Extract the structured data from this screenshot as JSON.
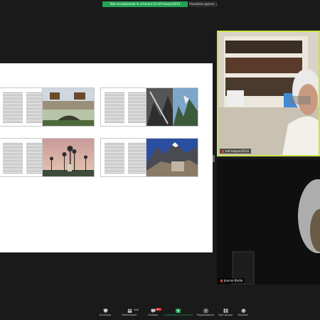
{
  "app": {
    "accent": "#23a455",
    "bg": "#1a1a1a"
  },
  "banner": {
    "share_text": "Stai visualizzando lo schermo di imf-macpro2014",
    "view_options_label": "Visualizza opzioni ⌄"
  },
  "slide": {
    "thumbnails": [
      {
        "kind": "text",
        "icon": "text-page-icon"
      },
      {
        "kind": "image",
        "subject": "stone bridge with elephant sculptures"
      },
      {
        "kind": "text",
        "icon": "text-page-icon"
      },
      {
        "kind": "image",
        "subject": "mountain valley diptych"
      },
      {
        "kind": "text",
        "icon": "text-page-icon"
      },
      {
        "kind": "image",
        "subject": "palm trees at dusk"
      },
      {
        "kind": "text",
        "icon": "text-page-icon"
      },
      {
        "kind": "image",
        "subject": "mountain with prayer stones"
      }
    ]
  },
  "participants": [
    {
      "name": "imf-macpro2014",
      "muted": true
    },
    {
      "name": "Jeanne Bodie",
      "muted": true
    }
  ],
  "toolbar": {
    "security": "Sicurezza",
    "participants": "Partecipanti",
    "participants_count": "308",
    "chat": "Chatbox",
    "chat_badge": "99+",
    "share": "Condividere lo schermo",
    "record": "Registrazione",
    "breakout": "Sale gruppi",
    "reactions": "Reazioni"
  }
}
